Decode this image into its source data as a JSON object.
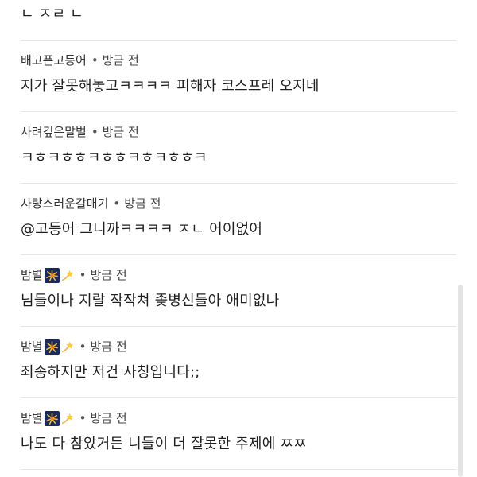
{
  "comments": [
    {
      "author": "",
      "time": "",
      "text": "ㄴ ㅈㄹ ㄴ"
    },
    {
      "author": "배고픈고등어",
      "time": "방금 전",
      "text": "지가 잘못해놓고ㅋㅋㅋㅋ 피해자 코스프레 오지네"
    },
    {
      "author": "사려깊은말벌",
      "time": "방금 전",
      "text": "ㅋㅎㅋㅎㅎㅋㅎㅎㅋㅎㅋㅎㅎㅋ"
    },
    {
      "author": "사랑스러운갈매기",
      "time": "방금 전",
      "text": "@고등어 그니까ㅋㅋㅋㅋ ㅈㄴ 어이없어"
    },
    {
      "author": "밤별",
      "time": "방금 전",
      "text": "님들이나 지랄 작작쳐 좆병신들아 애미없나"
    },
    {
      "author": "밤별",
      "time": "방금 전",
      "text": "죄송하지만 저건 사칭입니다;;"
    },
    {
      "author": "밤별",
      "time": "방금 전",
      "text": "나도 다 참았거든 니들이 더 잘못한 주제에 ㅉㅉ"
    }
  ],
  "separator": "•",
  "icons": {
    "author_badge": [
      "fireworks-icon",
      "dizzy-star-icon"
    ]
  },
  "colors": {
    "divider": "#e6e6e6",
    "text": "#1e1e1e",
    "meta": "#444444"
  }
}
